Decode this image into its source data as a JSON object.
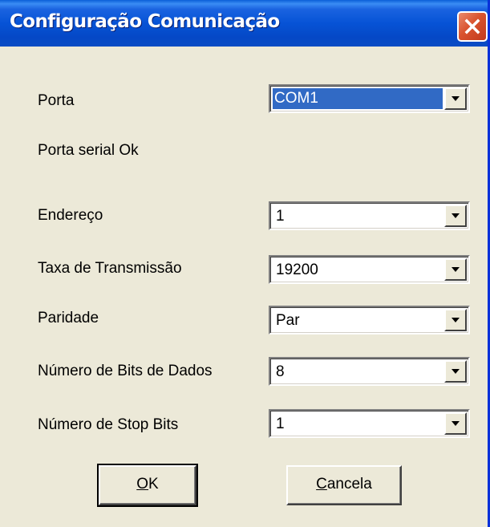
{
  "window": {
    "title": "Configuração Comunicação"
  },
  "icons": {
    "close": "close-icon",
    "dropdown": "chevron-down-icon"
  },
  "fields": {
    "porta": {
      "label": "Porta",
      "value": "COM1"
    },
    "status": {
      "text": "Porta serial Ok"
    },
    "endereco": {
      "label": "Endereço",
      "value": "1"
    },
    "taxa": {
      "label": "Taxa de Transmissão",
      "value": "19200"
    },
    "paridade": {
      "label": "Paridade",
      "value": "Par"
    },
    "bits_dados": {
      "label": "Número de Bits de Dados",
      "value": "8"
    },
    "stop_bits": {
      "label": "Número de Stop Bits",
      "value": "1"
    }
  },
  "buttons": {
    "ok": {
      "mnemonic": "O",
      "rest": "K"
    },
    "cancel": {
      "mnemonic": "C",
      "rest": "ancela"
    }
  },
  "colors": {
    "title_bar": "#0653d6",
    "selection": "#316ac5",
    "close_button": "#d9532e",
    "dialog_bg": "#ece9d8"
  }
}
